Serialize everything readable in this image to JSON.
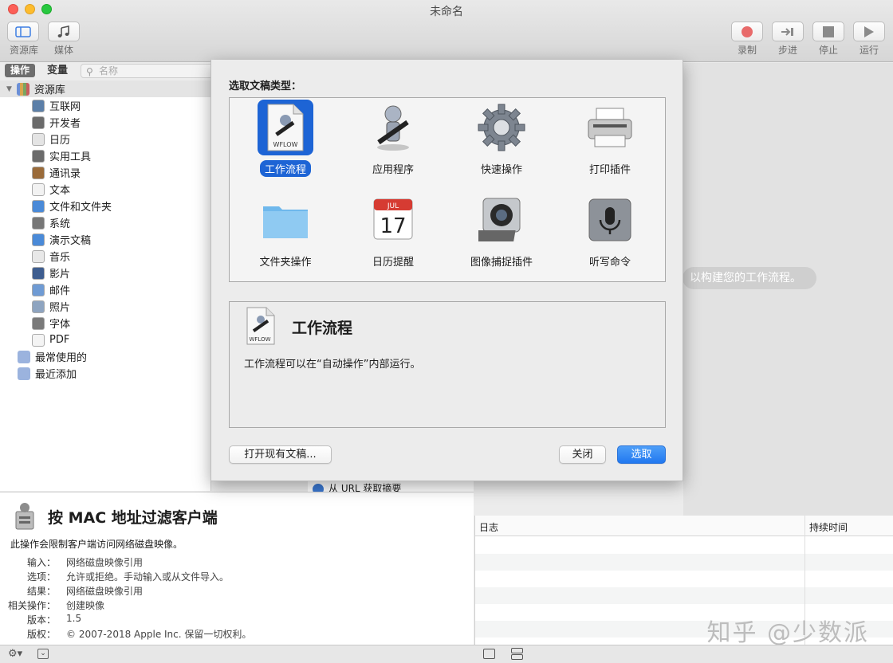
{
  "window": {
    "title": "未命名"
  },
  "toolbar": {
    "library_label": "资源库",
    "media_label": "媒体",
    "record_label": "录制",
    "step_label": "步进",
    "stop_label": "停止",
    "run_label": "运行"
  },
  "library": {
    "tab_actions": "操作",
    "tab_variables": "变量",
    "search_placeholder": "名称",
    "root": "资源库",
    "items": [
      "互联网",
      "开发者",
      "日历",
      "实用工具",
      "通讯录",
      "文本",
      "文件和文件夹",
      "系统",
      "演示文稿",
      "音乐",
      "影片",
      "邮件",
      "照片",
      "字体",
      "PDF"
    ],
    "groups": [
      "最常使用的",
      "最近添加"
    ],
    "hidden_row": "从 URL 获取摘要"
  },
  "description": {
    "title": "按 MAC 地址过滤客户端",
    "text": "此操作会限制客户端访问网络磁盘映像。",
    "meta": [
      {
        "key": "输入：",
        "value": "网络磁盘映像引用"
      },
      {
        "key": "选项：",
        "value": "允许或拒绝。手动输入或从文件导入。"
      },
      {
        "key": "结果：",
        "value": "网络磁盘映像引用"
      },
      {
        "key": "相关操作：",
        "value": "创建映像"
      },
      {
        "key": "版本：",
        "value": "1.5"
      },
      {
        "key": "版权：",
        "value": "© 2007-2018 Apple Inc. 保留一切权利。"
      }
    ]
  },
  "workflow": {
    "hint": "以构建您的工作流程。"
  },
  "log": {
    "col_log": "日志",
    "col_duration": "持续时间"
  },
  "sheet": {
    "prompt": "选取文稿类型：",
    "types": [
      {
        "label": "工作流程",
        "icon": "workflow-icon",
        "selected": true
      },
      {
        "label": "应用程序",
        "icon": "automator-robot-icon"
      },
      {
        "label": "快速操作",
        "icon": "gear-icon"
      },
      {
        "label": "打印插件",
        "icon": "printer-icon"
      },
      {
        "label": "文件夹操作",
        "icon": "folder-icon"
      },
      {
        "label": "日历提醒",
        "icon": "calendar-icon",
        "month": "JUL",
        "day": "17"
      },
      {
        "label": "图像捕捉插件",
        "icon": "camera-icon"
      },
      {
        "label": "听写命令",
        "icon": "microphone-icon"
      }
    ],
    "info_title": "工作流程",
    "info_text": "工作流程可以在“自动操作”内部运行。",
    "wflow_tag": "WFLOW",
    "open_button": "打开现有文稿...",
    "close_button": "关闭",
    "choose_button": "选取"
  },
  "watermark": "知乎 @少数派",
  "colors": {
    "selection": "#1d64d5",
    "primary_button": "#2178f0"
  }
}
